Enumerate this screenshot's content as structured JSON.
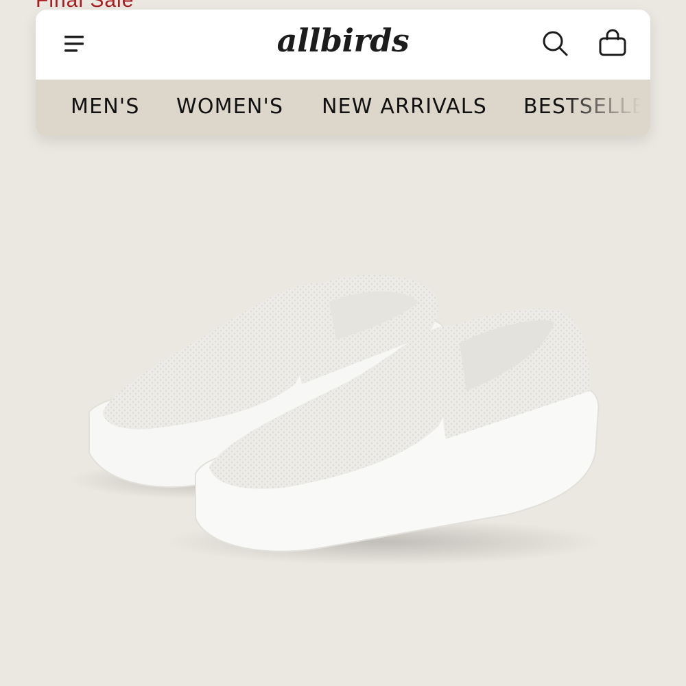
{
  "banner": {
    "final_sale_text": "Final Sale *"
  },
  "header": {
    "logo_text": "allbirds",
    "menu_icon": "hamburger-menu-icon",
    "search_icon": "search-icon",
    "cart_icon": "shopping-bag-icon"
  },
  "nav": {
    "items": [
      {
        "label": "MEN'S"
      },
      {
        "label": "WOMEN'S"
      },
      {
        "label": "NEW ARRIVALS"
      },
      {
        "label": "BESTSELLERS"
      }
    ]
  },
  "colors": {
    "page_background": "#ebe8e1",
    "nav_background": "#ddd7cb",
    "header_background": "#ffffff",
    "sale_red": "#a81c22",
    "text": "#111111"
  }
}
